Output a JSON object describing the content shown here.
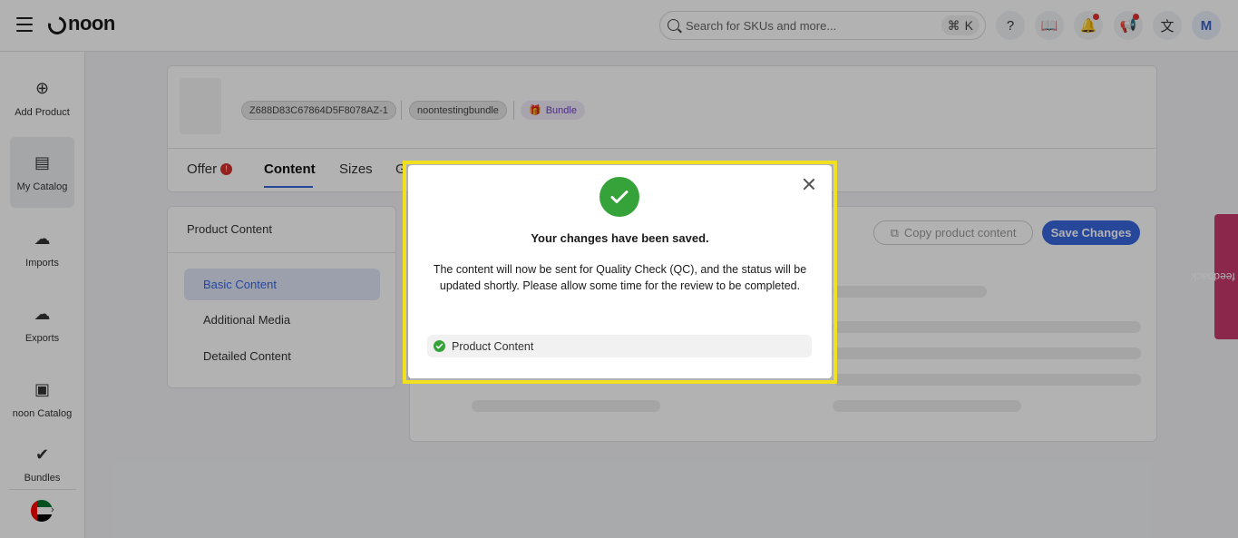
{
  "topbar": {
    "logo": "noon",
    "search": {
      "placeholder": "Search for SKUs and more...",
      "shortcut_mod": "⌘",
      "shortcut_key": "K"
    },
    "icons": [
      "help-icon",
      "book-icon",
      "bell-icon",
      "megaphone-icon",
      "translate-icon"
    ],
    "avatar_letter": "M"
  },
  "sidebar": {
    "items": [
      {
        "label": "Add Product",
        "icon": "plus-circle-icon"
      },
      {
        "label": "My Catalog",
        "icon": "catalog-icon"
      },
      {
        "label": "Imports",
        "icon": "cloud-upload-icon"
      },
      {
        "label": "Exports",
        "icon": "cloud-download-icon"
      },
      {
        "label": "noon Catalog",
        "icon": "book-icon"
      },
      {
        "label": "Bundles",
        "icon": "check-badge-icon"
      }
    ],
    "region": "uae-flag-icon"
  },
  "product": {
    "sku": "Z688D83C67864D5F8078AZ-1",
    "brand": "noontestingbundle",
    "type_label": "Bundle",
    "tabs": [
      {
        "label": "Offer"
      },
      {
        "label": "Content"
      },
      {
        "label": "Sizes"
      },
      {
        "label": "G"
      }
    ],
    "offer_badge": "!"
  },
  "content_nav": {
    "header": "Product Content",
    "items": [
      "Basic Content",
      "Additional Media",
      "Detailed Content"
    ]
  },
  "actions": {
    "copy_label": "Copy product content",
    "save_label": "Save Changes"
  },
  "feedback_label": "Give us feedback",
  "modal": {
    "title": "Your changes have been saved.",
    "body": "The content will now be sent for Quality Check (QC), and the status will be updated shortly. Please allow some time for the review to be completed.",
    "saved_items": [
      "Product Content"
    ]
  },
  "colors": {
    "primary": "#3866df",
    "success": "#36a33a",
    "highlight": "#f1e01f",
    "feedback": "#c6386b"
  }
}
